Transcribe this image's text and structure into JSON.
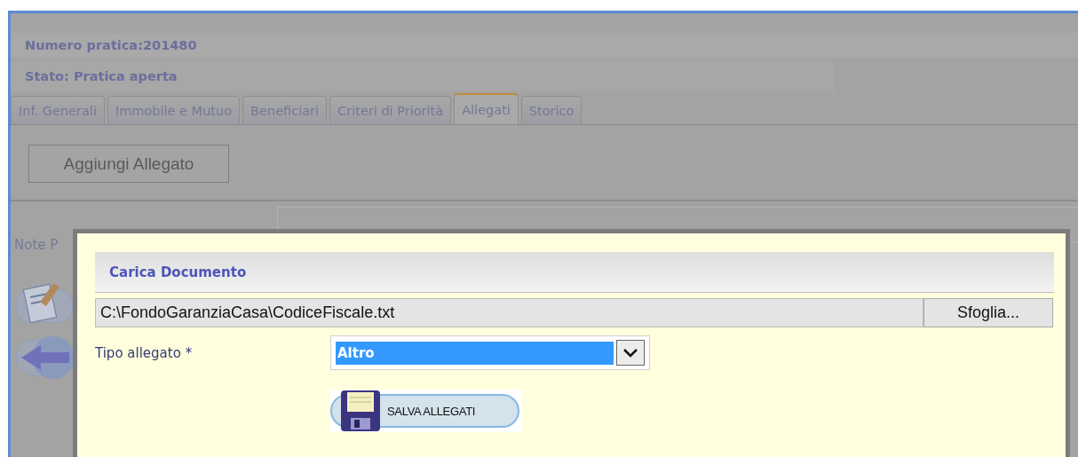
{
  "header": {
    "number": "Numero pratica:201480",
    "status": "Stato: Pratica aperta"
  },
  "tabs": [
    {
      "label": "Inf. Generali",
      "selected": false
    },
    {
      "label": "Immobile e Mutuo",
      "selected": false
    },
    {
      "label": "Beneficiari",
      "selected": false
    },
    {
      "label": "Criteri di Priorità",
      "selected": false
    },
    {
      "label": "Allegati",
      "selected": true
    },
    {
      "label": "Storico",
      "selected": false
    }
  ],
  "add_button": "Aggiungi Allegato",
  "notes_label": "Note P",
  "dialog": {
    "title": "Carica Documento",
    "file": {
      "value": "C:\\FondoGaranziaCasa\\CodiceFiscale.txt",
      "browse_button": "Sfoglia..."
    },
    "type_field": {
      "label": "Tipo allegato *",
      "value": "Altro"
    },
    "save_button": "SALVA ALLEGATI"
  }
}
